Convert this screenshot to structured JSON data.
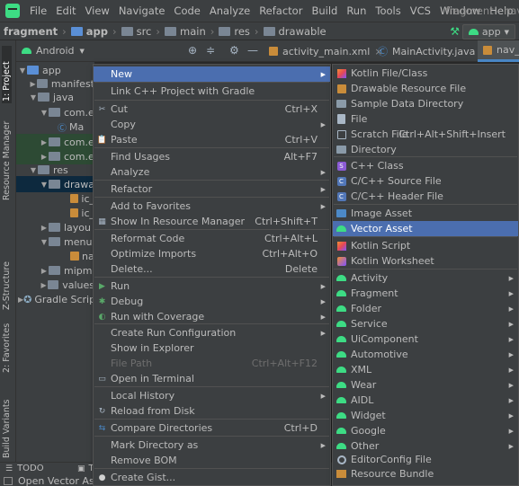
{
  "menubar": {
    "items": [
      "File",
      "Edit",
      "View",
      "Navigate",
      "Code",
      "Analyze",
      "Refactor",
      "Build",
      "Run",
      "Tools",
      "VCS",
      "Window",
      "Help"
    ],
    "title": "fragment - nav_"
  },
  "breadcrumbs": [
    "fragment",
    "app",
    "src",
    "main",
    "res",
    "drawable"
  ],
  "toolbar": {
    "run_config": "app"
  },
  "left_strip": {
    "project": "1: Project",
    "resource_manager": "Resource Manager",
    "structure": "Z-Structure",
    "favorites": "2: Favorites",
    "build_variants": "Build Variants"
  },
  "project_panel": {
    "view": "Android",
    "tree": [
      "app",
      "manifest",
      "java",
      "com.e",
      "Ma",
      "com.e",
      "com.e",
      "res",
      "drawa",
      "ic_",
      "ic_",
      "layou",
      "menu",
      "na",
      "mipm",
      "values",
      "Gradle Scrip"
    ]
  },
  "editor_tabs": [
    "activity_main.xml",
    "MainActivity.java",
    "nav_b"
  ],
  "bottom": {
    "todo": "TODO",
    "terminal": "Te",
    "status": "Open Vector Asse"
  },
  "context_menu": [
    {
      "label": "New",
      "shortcut": "",
      "submenu": true,
      "selected": true
    },
    {
      "label": "Link C++ Project with Gradle",
      "shortcut": "",
      "submenu": false
    },
    {
      "label": "Cut",
      "shortcut": "Ctrl+X",
      "submenu": false,
      "icon": "cut-icon"
    },
    {
      "label": "Copy",
      "shortcut": "",
      "submenu": true
    },
    {
      "label": "Paste",
      "shortcut": "Ctrl+V",
      "submenu": false,
      "icon": "paste-icon"
    },
    {
      "label": "Find Usages",
      "shortcut": "Alt+F7",
      "submenu": false
    },
    {
      "label": "Analyze",
      "shortcut": "",
      "submenu": true
    },
    {
      "label": "Refactor",
      "shortcut": "",
      "submenu": true
    },
    {
      "label": "Add to Favorites",
      "shortcut": "",
      "submenu": true
    },
    {
      "label": "Show In Resource Manager",
      "shortcut": "Ctrl+Shift+T",
      "submenu": false,
      "icon": "resource-manager-icon"
    },
    {
      "label": "Reformat Code",
      "shortcut": "Ctrl+Alt+L",
      "submenu": false
    },
    {
      "label": "Optimize Imports",
      "shortcut": "Ctrl+Alt+O",
      "submenu": false
    },
    {
      "label": "Delete...",
      "shortcut": "Delete",
      "submenu": false
    },
    {
      "label": "Run",
      "shortcut": "",
      "submenu": true,
      "icon": "run-icon"
    },
    {
      "label": "Debug",
      "shortcut": "",
      "submenu": true,
      "icon": "debug-icon"
    },
    {
      "label": "Run with Coverage",
      "shortcut": "",
      "submenu": true,
      "icon": "coverage-icon"
    },
    {
      "label": "Create Run Configuration",
      "shortcut": "",
      "submenu": true
    },
    {
      "label": "Show in Explorer",
      "shortcut": "",
      "submenu": false
    },
    {
      "label": "File Path",
      "shortcut": "Ctrl+Alt+F12",
      "submenu": false,
      "disabled": true
    },
    {
      "label": "Open in Terminal",
      "shortcut": "",
      "submenu": false,
      "icon": "terminal-icon"
    },
    {
      "label": "Local History",
      "shortcut": "",
      "submenu": true
    },
    {
      "label": "Reload from Disk",
      "shortcut": "",
      "submenu": false,
      "icon": "reload-icon"
    },
    {
      "label": "Compare Directories",
      "shortcut": "Ctrl+D",
      "submenu": false,
      "icon": "compare-icon"
    },
    {
      "label": "Mark Directory as",
      "shortcut": "",
      "submenu": true
    },
    {
      "label": "Remove BOM",
      "shortcut": "",
      "submenu": false
    },
    {
      "label": "Create Gist...",
      "shortcut": "",
      "submenu": false,
      "icon": "github-icon"
    }
  ],
  "new_submenu": [
    {
      "label": "Kotlin File/Class",
      "shortcut": "",
      "submenu": false,
      "icon": "kotlin-icon"
    },
    {
      "label": "Drawable Resource File",
      "shortcut": "",
      "submenu": false,
      "icon": "resource-file-icon"
    },
    {
      "label": "Sample Data Directory",
      "shortcut": "",
      "submenu": false,
      "icon": "folder-icon"
    },
    {
      "label": "File",
      "shortcut": "",
      "submenu": false,
      "icon": "file-icon"
    },
    {
      "label": "Scratch File",
      "shortcut": "Ctrl+Alt+Shift+Insert",
      "submenu": false,
      "icon": "scratch-icon"
    },
    {
      "label": "Directory",
      "shortcut": "",
      "submenu": false,
      "icon": "folder-icon"
    },
    {
      "label": "C++ Class",
      "shortcut": "",
      "submenu": false,
      "icon": "cpp-icon"
    },
    {
      "label": "C/C++ Source File",
      "shortcut": "",
      "submenu": false,
      "icon": "cpp-source-icon"
    },
    {
      "label": "C/C++ Header File",
      "shortcut": "",
      "submenu": false,
      "icon": "cpp-header-icon"
    },
    {
      "label": "Image Asset",
      "shortcut": "",
      "submenu": false,
      "icon": "image-icon"
    },
    {
      "label": "Vector Asset",
      "shortcut": "",
      "submenu": false,
      "icon": "android-icon",
      "selected": true
    },
    {
      "label": "Kotlin Script",
      "shortcut": "",
      "submenu": false,
      "icon": "kotlin-icon"
    },
    {
      "label": "Kotlin Worksheet",
      "shortcut": "",
      "submenu": false,
      "icon": "kotlin-worksheet-icon"
    },
    {
      "label": "Activity",
      "shortcut": "",
      "submenu": true,
      "icon": "android-icon"
    },
    {
      "label": "Fragment",
      "shortcut": "",
      "submenu": true,
      "icon": "android-icon"
    },
    {
      "label": "Folder",
      "shortcut": "",
      "submenu": true,
      "icon": "android-icon"
    },
    {
      "label": "Service",
      "shortcut": "",
      "submenu": true,
      "icon": "android-icon"
    },
    {
      "label": "UiComponent",
      "shortcut": "",
      "submenu": true,
      "icon": "android-icon"
    },
    {
      "label": "Automotive",
      "shortcut": "",
      "submenu": true,
      "icon": "android-icon"
    },
    {
      "label": "XML",
      "shortcut": "",
      "submenu": true,
      "icon": "android-icon"
    },
    {
      "label": "Wear",
      "shortcut": "",
      "submenu": true,
      "icon": "android-icon"
    },
    {
      "label": "AIDL",
      "shortcut": "",
      "submenu": true,
      "icon": "android-icon"
    },
    {
      "label": "Widget",
      "shortcut": "",
      "submenu": true,
      "icon": "android-icon"
    },
    {
      "label": "Google",
      "shortcut": "",
      "submenu": true,
      "icon": "android-icon"
    },
    {
      "label": "Other",
      "shortcut": "",
      "submenu": true,
      "icon": "android-icon"
    },
    {
      "label": "EditorConfig File",
      "shortcut": "",
      "submenu": false,
      "icon": "gear-icon"
    },
    {
      "label": "Resource Bundle",
      "shortcut": "",
      "submenu": false,
      "icon": "resource-bundle-icon"
    }
  ],
  "colors": {
    "selection": "#4b6eaf",
    "background": "#3c3f41",
    "android_green": "#3ddc84"
  }
}
